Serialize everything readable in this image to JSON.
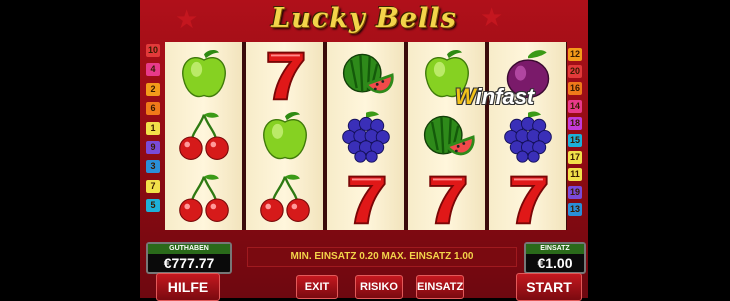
{
  "title": "Lucky Bells",
  "watermark": {
    "w": "W",
    "rest": "infast"
  },
  "lines_left": [
    "10",
    "4",
    "2",
    "6",
    "1",
    "9",
    "3",
    "7",
    "5"
  ],
  "lines_right": [
    "12",
    "20",
    "16",
    "14",
    "18",
    "15",
    "17",
    "11",
    "19",
    "13"
  ],
  "line_colors": [
    "#f2e04a",
    "#f39a1a",
    "#2a8fd8",
    "#e83a8a",
    "#1db0d8",
    "#f07a1a",
    "#f2e04a",
    "#c33ad8",
    "#7a4ad8",
    "#e23a3a"
  ],
  "reels": [
    [
      "apple",
      "cherries",
      "cherries"
    ],
    [
      "seven",
      "apple",
      "cherries"
    ],
    [
      "watermelon",
      "grapes",
      "seven"
    ],
    [
      "apple",
      "watermelon",
      "seven"
    ],
    [
      "plum",
      "grapes",
      "seven"
    ]
  ],
  "balance": {
    "label": "GUTHABEN",
    "value": "€777.77"
  },
  "stake": {
    "label": "EINSATZ",
    "value": "€1.00"
  },
  "message": "MIN. EINSATZ 0.20 MAX. EINSATZ 1.00",
  "buttons": {
    "help": "HILFE",
    "exit": "EXIT",
    "risk": "RISIKO",
    "stake": "EINSATZ",
    "start": "START"
  },
  "colors": {
    "frame": "#b0101a",
    "gold": "#f3d44a"
  }
}
